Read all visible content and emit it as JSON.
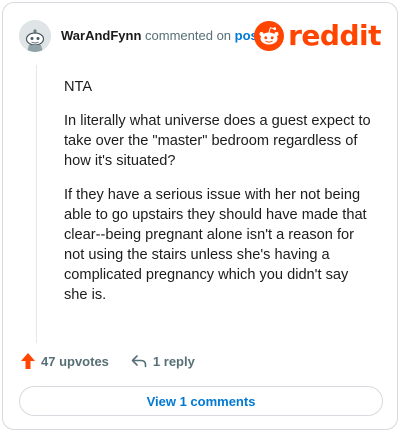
{
  "comment": {
    "username": "WarAndFynn",
    "action_text": "commented on",
    "post_link": "post",
    "paragraphs": [
      "NTA",
      "In literally what universe does a guest expect to take over the \"master\" bedroom regardless of how it's situated?",
      "If they have a serious issue with her not being able to go upstairs they should have made that clear--being pregnant alone isn't a reason for not using the stairs unless she's having a complicated pregnancy which you didn't say she is."
    ]
  },
  "brand": {
    "wordmark": "reddit",
    "color": "#ff4500"
  },
  "actions": {
    "upvotes_label": "47 upvotes",
    "reply_label": "1 reply"
  },
  "view_comments_label": "View 1 comments",
  "colors": {
    "accent_blue": "#0079d3",
    "upvote_orange": "#ff4500",
    "muted_text": "#576f76"
  }
}
